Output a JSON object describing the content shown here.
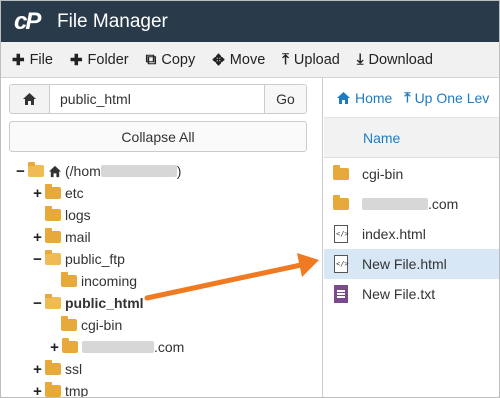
{
  "app": {
    "logo": "cP",
    "title": "File Manager"
  },
  "toolbar": [
    {
      "icon": "plus-icon",
      "glyph": "✚",
      "label": "File"
    },
    {
      "icon": "plus-icon",
      "glyph": "✚",
      "label": "Folder"
    },
    {
      "icon": "copy-icon",
      "glyph": "⧉",
      "label": "Copy"
    },
    {
      "icon": "move-icon",
      "glyph": "✥",
      "label": "Move"
    },
    {
      "icon": "upload-icon",
      "glyph": "⤒",
      "label": "Upload"
    },
    {
      "icon": "download-icon",
      "glyph": "⤓",
      "label": "Download"
    }
  ],
  "path_bar": {
    "value": "public_html",
    "go_label": "Go"
  },
  "collapse_label": "Collapse All",
  "tree": {
    "root_open": "(/hom",
    "root_close": ")",
    "items": [
      {
        "toggle": "+",
        "label": "etc"
      },
      {
        "toggle": "",
        "label": "logs"
      },
      {
        "toggle": "+",
        "label": "mail"
      },
      {
        "toggle": "−",
        "label": "public_ftp"
      },
      {
        "toggle": "",
        "label": "incoming"
      },
      {
        "toggle": "−",
        "label": "public_html"
      },
      {
        "toggle": "",
        "label": "cgi-bin"
      },
      {
        "toggle": "+",
        "label": ".com"
      },
      {
        "toggle": "+",
        "label": "ssl"
      },
      {
        "toggle": "+",
        "label": "tmp"
      }
    ]
  },
  "nav": {
    "home": "Home",
    "up": "Up One Lev"
  },
  "list": {
    "header": "Name",
    "files": [
      {
        "type": "folder",
        "name": "cgi-bin"
      },
      {
        "type": "folder",
        "name": ".com"
      },
      {
        "type": "html",
        "name": "index.html"
      },
      {
        "type": "html",
        "name": "New File.html"
      },
      {
        "type": "text",
        "name": "New File.txt"
      }
    ]
  },
  "colors": {
    "header": "#293a4a",
    "accent": "#1f7bc1",
    "arrow": "#f07a22",
    "folder": "#e8a93c",
    "selected_row": "#d8e7f5"
  }
}
